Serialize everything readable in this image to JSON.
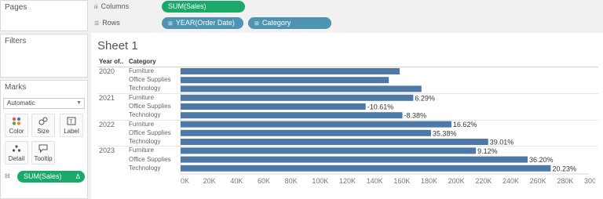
{
  "panes": {
    "pages_title": "Pages",
    "filters_title": "Filters",
    "marks_title": "Marks"
  },
  "marks": {
    "type": "Automatic",
    "buttons": [
      {
        "label": "Color",
        "icon": "color-icon"
      },
      {
        "label": "Size",
        "icon": "size-icon"
      },
      {
        "label": "Label",
        "icon": "label-icon"
      },
      {
        "label": "Detail",
        "icon": "detail-icon"
      },
      {
        "label": "Tooltip",
        "icon": "tooltip-icon"
      }
    ],
    "pill": "SUM(Sales)",
    "pill_icon": "Δ"
  },
  "shelves": {
    "columns_label": "Columns",
    "columns_pill": "SUM(Sales)",
    "rows_label": "Rows",
    "rows_pills": [
      "YEAR(Order Date)",
      "Category"
    ]
  },
  "sheet": {
    "title": "Sheet 1",
    "header_year": "Year of..",
    "header_category": "Category"
  },
  "colors": {
    "bar": "#4e79a7",
    "pill_green": "#1aa86b",
    "pill_blue": "#4f93b3"
  },
  "chart_data": {
    "type": "bar",
    "orientation": "horizontal",
    "xlim": [
      0,
      300000
    ],
    "ticks": [
      "0K",
      "20K",
      "40K",
      "60K",
      "80K",
      "100K",
      "120K",
      "140K",
      "160K",
      "180K",
      "200K",
      "220K",
      "240K",
      "260K",
      "280K",
      "300K"
    ],
    "groups": [
      {
        "year": "2020",
        "rows": [
          {
            "category": "Furniture",
            "value": 161000,
            "label": ""
          },
          {
            "category": "Office Supplies",
            "value": 153000,
            "label": ""
          },
          {
            "category": "Technology",
            "value": 177000,
            "label": ""
          }
        ]
      },
      {
        "year": "2021",
        "rows": [
          {
            "category": "Furniture",
            "value": 171000,
            "label": "6.29%"
          },
          {
            "category": "Office Supplies",
            "value": 136000,
            "label": "-10.61%"
          },
          {
            "category": "Technology",
            "value": 163000,
            "label": "-8.38%"
          }
        ]
      },
      {
        "year": "2022",
        "rows": [
          {
            "category": "Furniture",
            "value": 199000,
            "label": "16.62%"
          },
          {
            "category": "Office Supplies",
            "value": 184000,
            "label": "35.38%"
          },
          {
            "category": "Technology",
            "value": 226000,
            "label": "39.01%"
          }
        ]
      },
      {
        "year": "2023",
        "rows": [
          {
            "category": "Furniture",
            "value": 217000,
            "label": "9.12%"
          },
          {
            "category": "Office Supplies",
            "value": 255000,
            "label": "36.20%"
          },
          {
            "category": "Technology",
            "value": 272000,
            "label": "20.23%"
          }
        ]
      }
    ]
  }
}
